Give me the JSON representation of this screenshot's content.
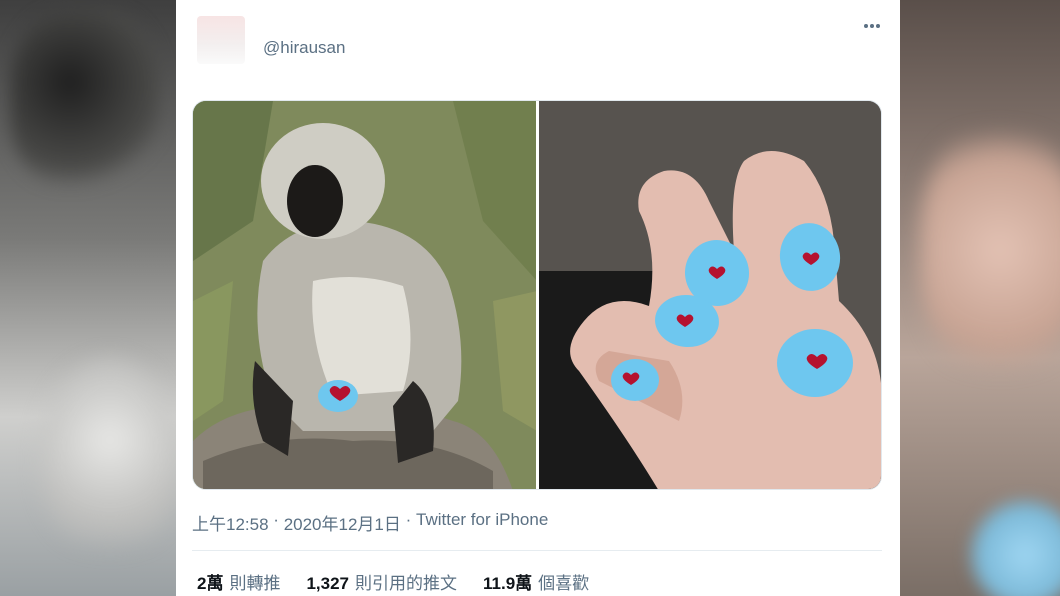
{
  "tweet": {
    "handle": "@hirausan",
    "time": "上午12:58",
    "separator": "·",
    "date": "2020年12月1日",
    "source": "Twitter for iPhone",
    "images": [
      {
        "name": "vervet-monkey-photo"
      },
      {
        "name": "blue-nails-photo"
      }
    ]
  },
  "stats": [
    {
      "num": "2萬",
      "label": "則轉推"
    },
    {
      "num": "1,327",
      "label": "則引用的推文"
    },
    {
      "num": "11.9萬",
      "label": "個喜歡"
    }
  ],
  "colors": {
    "nail_blue": "#6ec7ef",
    "heart_red": "#b5122f",
    "secondary_text": "#5b7083"
  }
}
